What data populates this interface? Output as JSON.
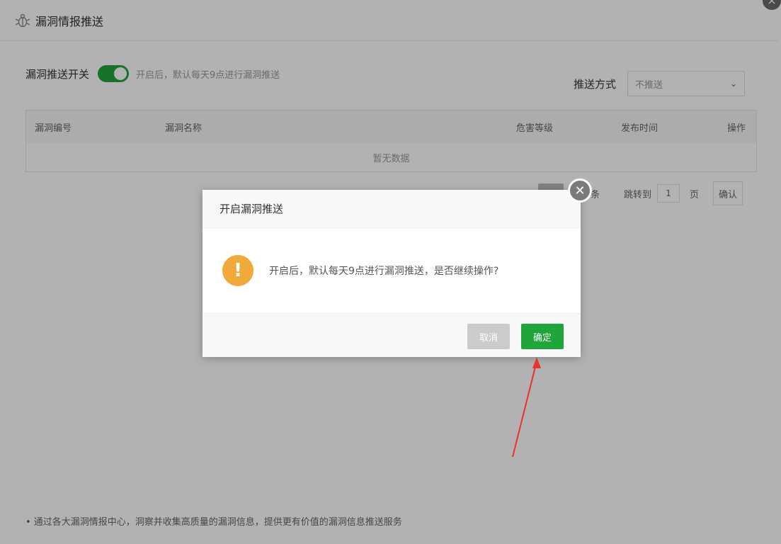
{
  "panel": {
    "title": "漏洞情报推送",
    "close_icon": "×"
  },
  "toggle": {
    "label": "漏洞推送开关",
    "state": "on",
    "hint": "开启后，默认每天9点进行漏洞推送"
  },
  "push_mode": {
    "label": "推送方式",
    "selected": "不推送"
  },
  "table": {
    "columns": [
      "漏洞编号",
      "漏洞名称",
      "危害等级",
      "发布时间",
      "操作"
    ],
    "empty_text": "暂无数据"
  },
  "pager": {
    "tiao": "条",
    "jump_label": "跳转到",
    "page_value": "1",
    "ye": "页",
    "confirm": "确认"
  },
  "footnote": "• 通过各大漏洞情报中心，洞察并收集高质量的漏洞信息，提供更有价值的漏洞信息推送服务",
  "dialog": {
    "title": "开启漏洞推送",
    "close_icon": "✕",
    "warn_icon": "!",
    "message": "开启后，默认每天9点进行漏洞推送，是否继续操作?",
    "cancel": "取消",
    "ok": "确定"
  },
  "colors": {
    "accent": "#20a53a",
    "warning": "#f0a93b",
    "arrow": "#e8322e"
  }
}
